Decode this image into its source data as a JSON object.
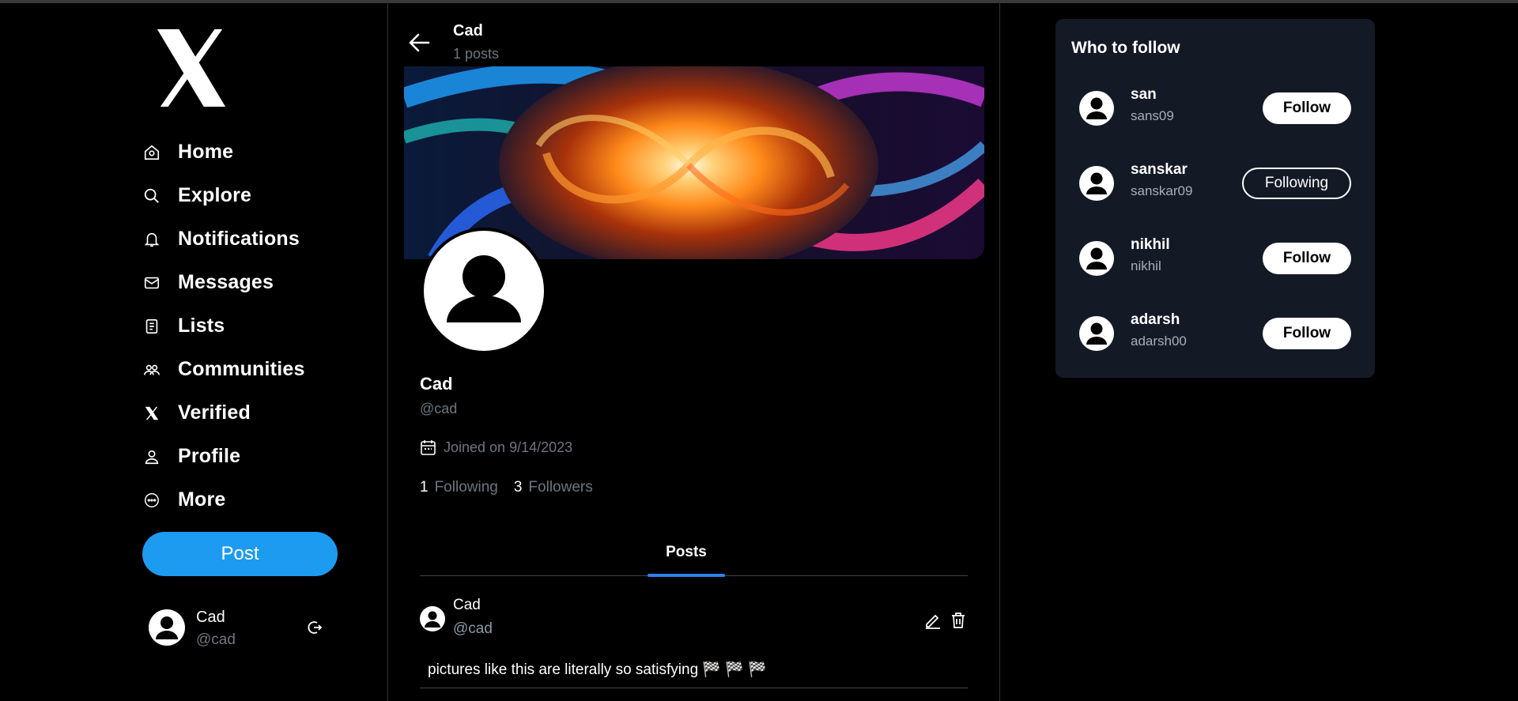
{
  "sidebar": {
    "items": [
      {
        "label": "Home",
        "icon": "home-icon"
      },
      {
        "label": "Explore",
        "icon": "search-icon"
      },
      {
        "label": "Notifications",
        "icon": "bell-icon"
      },
      {
        "label": "Messages",
        "icon": "mail-icon"
      },
      {
        "label": "Lists",
        "icon": "list-icon"
      },
      {
        "label": "Communities",
        "icon": "communities-icon"
      },
      {
        "label": "Verified",
        "icon": "x-icon"
      },
      {
        "label": "Profile",
        "icon": "user-icon"
      },
      {
        "label": "More",
        "icon": "more-icon"
      }
    ],
    "post_label": "Post",
    "account": {
      "name": "Cad",
      "handle": "@cad"
    }
  },
  "header": {
    "name": "Cad",
    "post_count": "1 posts"
  },
  "profile": {
    "name": "Cad",
    "handle": "@cad",
    "joined": "Joined on 9/14/2023",
    "following_count": "1",
    "following_label": "Following",
    "followers_count": "3",
    "followers_label": "Followers"
  },
  "tabs": {
    "posts": "Posts"
  },
  "post": {
    "author": "Cad",
    "handle": "@cad",
    "text": "pictures like this are literally so satisfying 🏁 🏁 🏁"
  },
  "who_to_follow": {
    "title": "Who to follow",
    "users": [
      {
        "name": "san",
        "handle": "sans09",
        "button": "Follow"
      },
      {
        "name": "sanskar",
        "handle": "sanskar09",
        "button": "Following"
      },
      {
        "name": "nikhil",
        "handle": "nikhil",
        "button": "Follow"
      },
      {
        "name": "adarsh",
        "handle": "adarsh00",
        "button": "Follow"
      }
    ]
  },
  "colors": {
    "accent": "#1d9bf0",
    "panel": "#131a26",
    "tab_indicator": "#2f80ed",
    "muted": "#6e767d"
  }
}
